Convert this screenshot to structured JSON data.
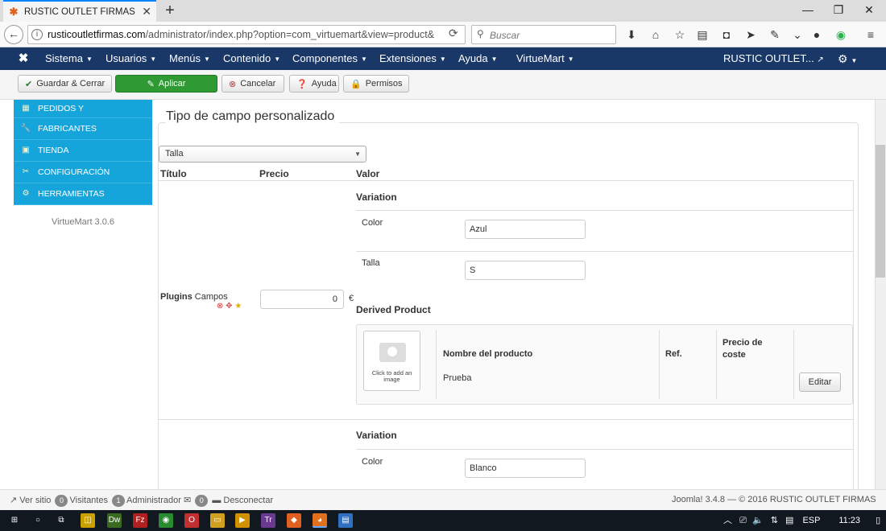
{
  "browser": {
    "tab_title": "RUSTIC OUTLET FIRMAS -...",
    "url_domain": "rusticoutletfirmas.com",
    "url_path": "/administrator/index.php?option=com_virtuemart&view=product&",
    "search_placeholder": "Buscar"
  },
  "joomla_nav": {
    "menus": [
      "Sistema",
      "Usuarios",
      "Menús",
      "Contenido",
      "Componentes",
      "Extensiones",
      "Ayuda"
    ],
    "virtuemart": "VirtueMart",
    "site_name": "RUSTIC OUTLET..."
  },
  "toolbar": {
    "save_close": "Guardar & Cerrar",
    "apply": "Aplicar",
    "cancel": "Cancelar",
    "help": "Ayuda",
    "permissions": "Permisos"
  },
  "sidebar": {
    "items": [
      {
        "label": "PEDIDOS Y",
        "icon": "orders-icon"
      },
      {
        "label": "FABRICANTES",
        "icon": "wrench-icon"
      },
      {
        "label": "TIENDA",
        "icon": "store-icon"
      },
      {
        "label": "CONFIGURACIÓN",
        "icon": "config-icon"
      },
      {
        "label": "HERRAMIENTAS",
        "icon": "tools-icon"
      }
    ],
    "version": "VirtueMart 3.0.6"
  },
  "main": {
    "legend": "Tipo de campo personalizado",
    "select_value": "Talla",
    "columns": {
      "title": "Título",
      "price": "Precio",
      "value": "Valor"
    },
    "row1": {
      "plugin_label_bold": "Plugins",
      "plugin_label": "Campos",
      "price": "0",
      "currency": "€",
      "variation_heading": "Variation",
      "fields": [
        {
          "label": "Color",
          "value": "Azul"
        },
        {
          "label": "Talla",
          "value": "S"
        }
      ],
      "derived_heading": "Derived Product",
      "image_caption": "Click to add an image",
      "headers": {
        "name": "Nombre del producto",
        "ref": "Ref.",
        "cost": "Precio de coste"
      },
      "product_name": "Prueba",
      "edit_button": "Editar"
    },
    "row2": {
      "variation_heading": "Variation",
      "fields": [
        {
          "label": "Color",
          "value": "Blanco"
        }
      ]
    }
  },
  "statusbar": {
    "view_site": "Ver sitio",
    "visitors_count": "0",
    "visitors": "Visitantes",
    "admin_count": "1",
    "admin": "Administrador",
    "msg_count": "0",
    "logout": "Desconectar",
    "copyright": "Joomla! 3.4.8 — © 2016 RUSTIC OUTLET FIRMAS"
  },
  "taskbar": {
    "lang": "ESP",
    "time": "11:23"
  },
  "colors": {
    "joomla_nav": "#1a3867",
    "sidebar": "#16a5db",
    "apply_green": "#2f9a33"
  }
}
